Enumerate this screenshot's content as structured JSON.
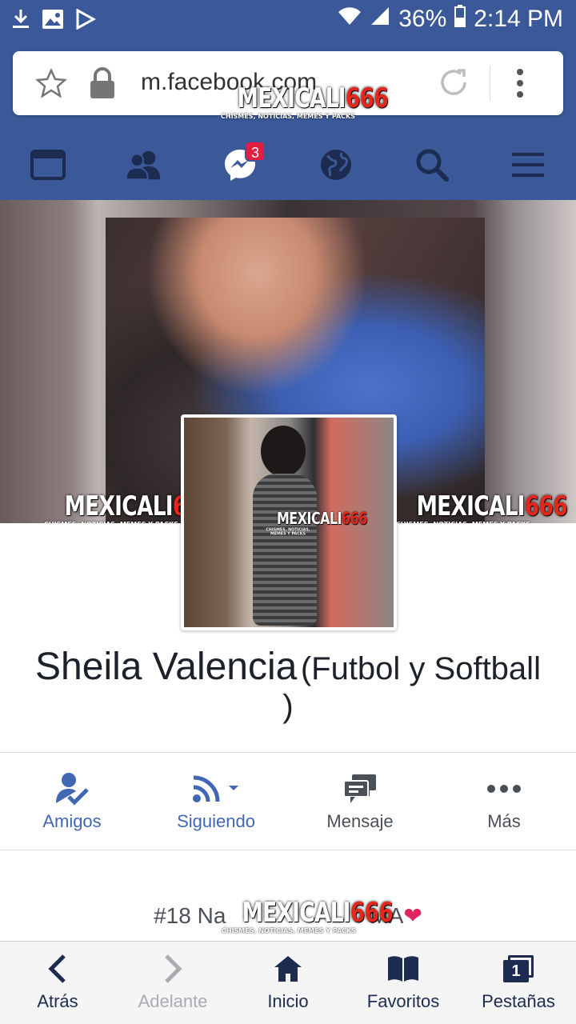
{
  "status_bar": {
    "battery": "36%",
    "time": "2:14 PM"
  },
  "url_bar": {
    "url": "m.facebook.com"
  },
  "watermark": {
    "main": "MEXICALI",
    "num": "666",
    "sub": "CHISMES, NOTICIAS, MEMES Y PACKS"
  },
  "fb_nav": {
    "messages_badge": "3"
  },
  "profile": {
    "name": "Sheila Valencia",
    "alt_name": "(Futbol y Softball",
    "alt_name_close": ")",
    "bio_prefix": "#18 Na",
    "bio_suffix": "MA",
    "bio_emoji": "❤"
  },
  "actions": [
    {
      "label": "Amigos"
    },
    {
      "label": "Siguiendo"
    },
    {
      "label": "Mensaje"
    },
    {
      "label": "Más"
    }
  ],
  "bottom_bar": [
    {
      "label": "Atrás"
    },
    {
      "label": "Adelante"
    },
    {
      "label": "Inicio"
    },
    {
      "label": "Favoritos"
    },
    {
      "label": "Pestañas",
      "count": "1"
    }
  ],
  "colors": {
    "fb_blue": "#3b5998",
    "action_blue": "#4267b2",
    "badge_red": "#e41e3f"
  }
}
